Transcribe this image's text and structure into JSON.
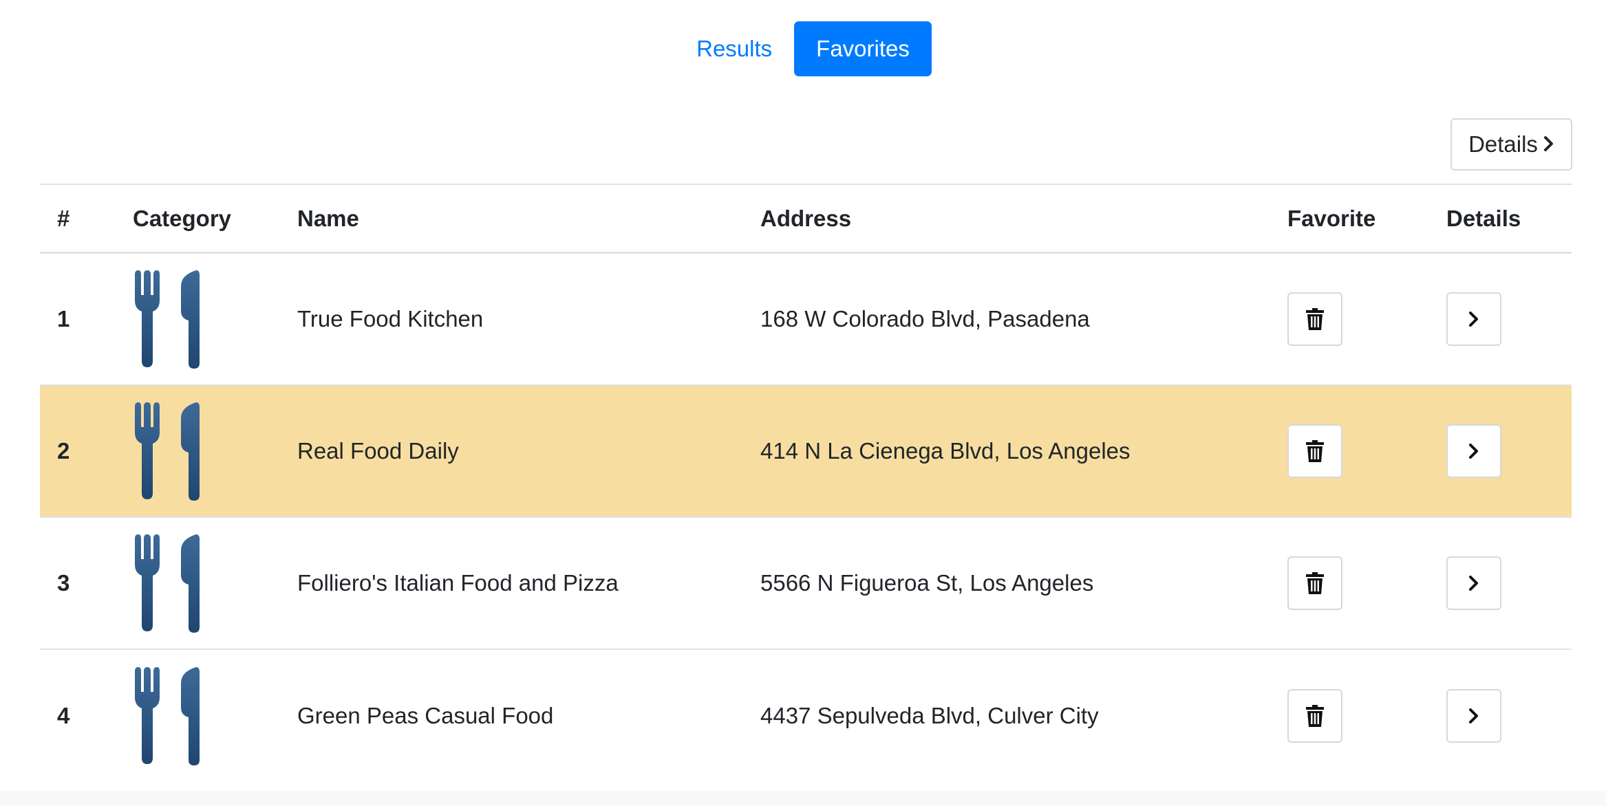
{
  "tabs": [
    {
      "label": "Results",
      "active": false
    },
    {
      "label": "Favorites",
      "active": true
    }
  ],
  "details_button": {
    "label": "Details",
    "icon": "chevron-right-icon"
  },
  "table": {
    "headers": [
      "#",
      "Category",
      "Name",
      "Address",
      "Favorite",
      "Details"
    ],
    "rows": [
      {
        "num": "1",
        "category_icon": "fork-knife-icon",
        "name": "True Food Kitchen",
        "address": "168 W Colorado Blvd, Pasadena",
        "highlight": false
      },
      {
        "num": "2",
        "category_icon": "fork-knife-icon",
        "name": "Real Food Daily",
        "address": "414 N La Cienega Blvd, Los Angeles",
        "highlight": true
      },
      {
        "num": "3",
        "category_icon": "fork-knife-icon",
        "name": "Folliero's Italian Food and Pizza",
        "address": "5566 N Figueroa St, Los Angeles",
        "highlight": false
      },
      {
        "num": "4",
        "category_icon": "fork-knife-icon",
        "name": "Green Peas Casual Food",
        "address": "4437 Sepulveda Blvd, Culver City",
        "highlight": false
      }
    ]
  },
  "colors": {
    "accent": "#007bff",
    "highlight_row": "#f7dea0",
    "icon": "#2d5580"
  }
}
